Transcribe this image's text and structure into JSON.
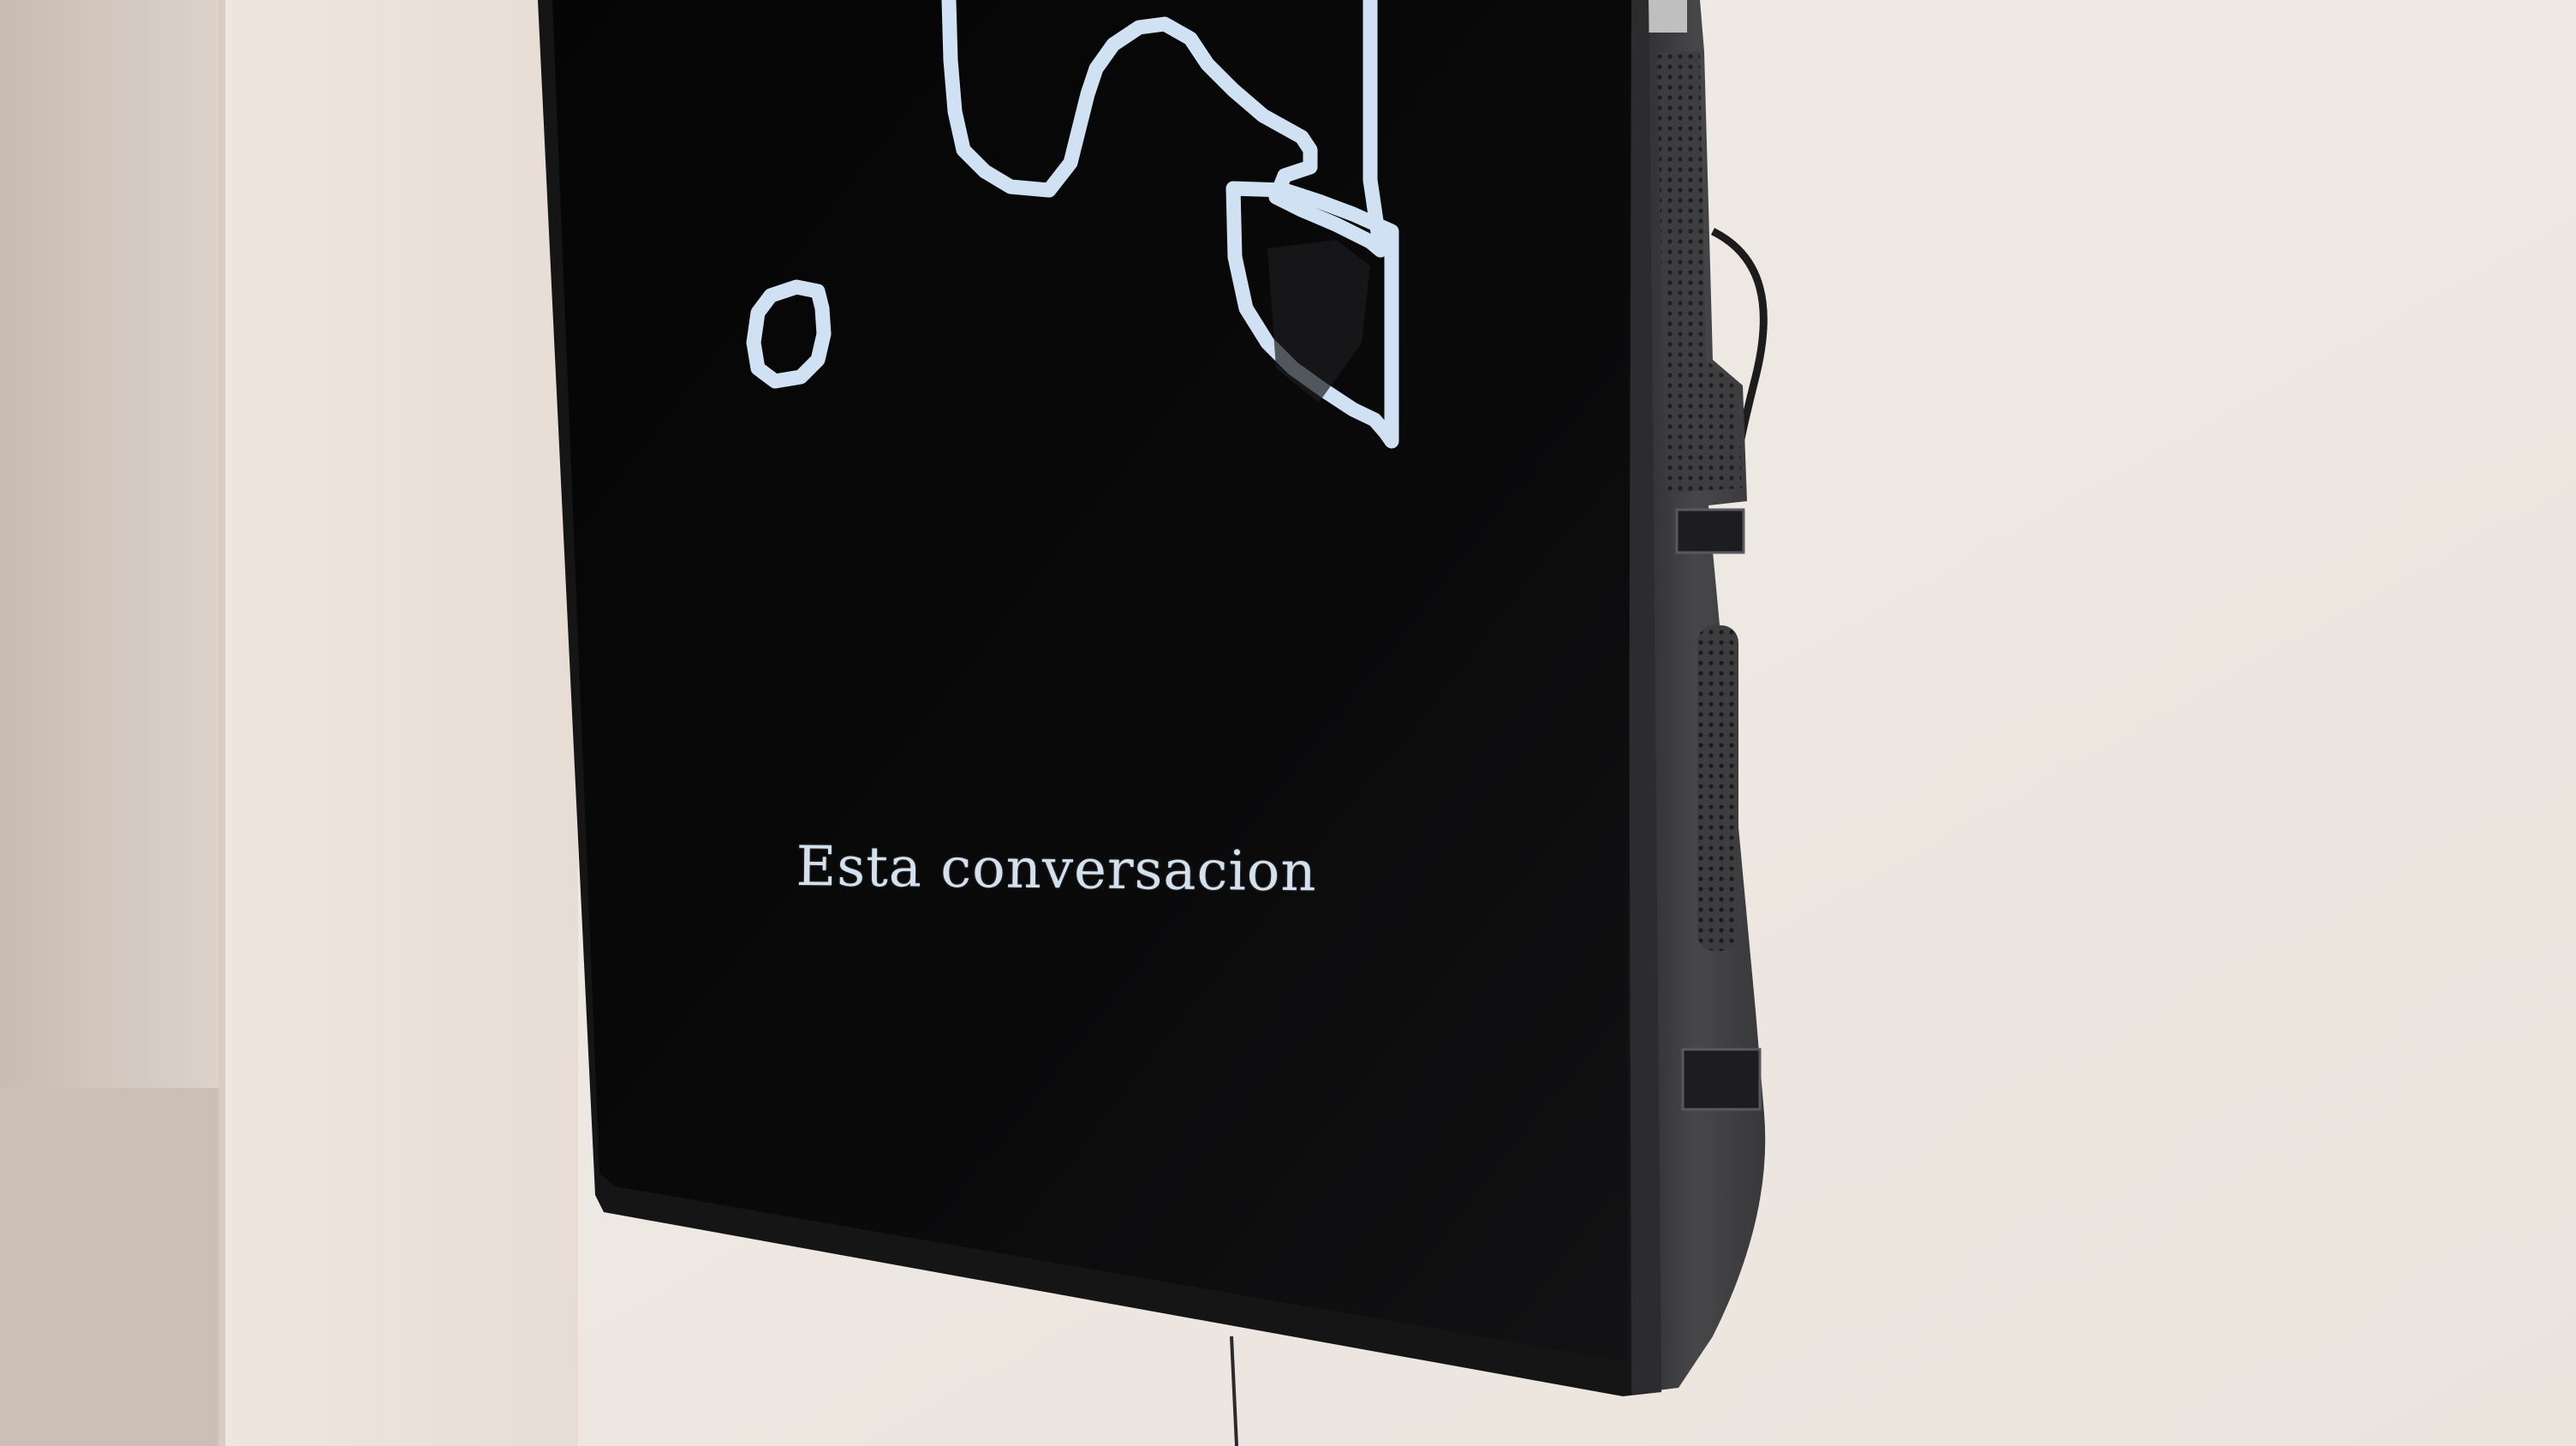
{
  "screen": {
    "caption": "Esta conversacion"
  }
}
